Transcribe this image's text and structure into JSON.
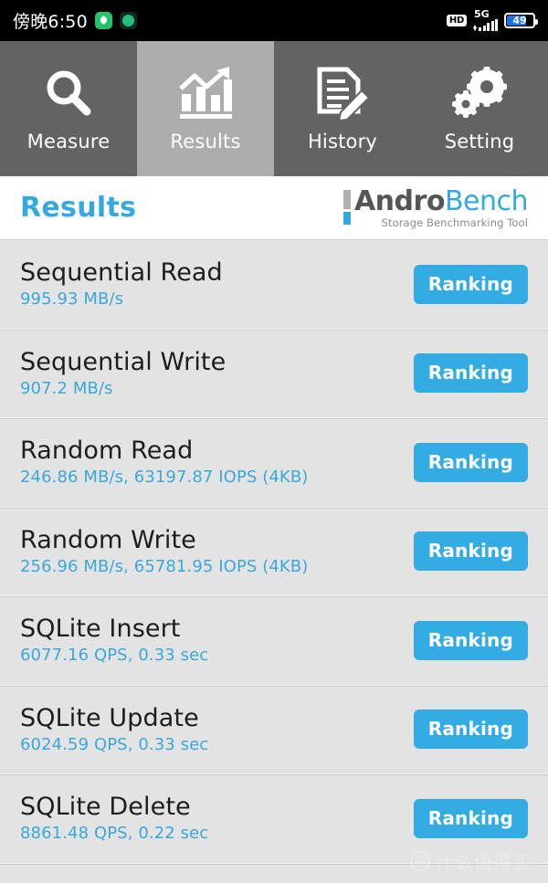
{
  "statusbar": {
    "time": "傍晚6:50",
    "app_icon_1": "shield-app-icon",
    "app_icon_2": "circle-app-icon",
    "hd_label": "HD",
    "network_label": "5G",
    "signal_icon": "signal-bars-icon",
    "battery_percent": "49",
    "battery_icon": "battery-icon"
  },
  "tabs": [
    {
      "label": "Measure",
      "icon": "magnifier-icon",
      "active": false
    },
    {
      "label": "Results",
      "icon": "bar-chart-icon",
      "active": true
    },
    {
      "label": "History",
      "icon": "document-pencil-icon",
      "active": false
    },
    {
      "label": "Setting",
      "icon": "gears-icon",
      "active": false
    }
  ],
  "header": {
    "title": "Results",
    "logo_andro": "Andro",
    "logo_bench": "Bench",
    "logo_subtitle": "Storage Benchmarking Tool"
  },
  "results": {
    "ranking_label": "Ranking",
    "rows": [
      {
        "name": "Sequential Read",
        "value": "995.93 MB/s"
      },
      {
        "name": "Sequential Write",
        "value": "907.2 MB/s"
      },
      {
        "name": "Random Read",
        "value": "246.86 MB/s, 63197.87 IOPS (4KB)"
      },
      {
        "name": "Random Write",
        "value": "256.96 MB/s, 65781.95 IOPS (4KB)"
      },
      {
        "name": "SQLite Insert",
        "value": "6077.16 QPS, 0.33 sec"
      },
      {
        "name": "SQLite Update",
        "value": "6024.59 QPS, 0.33 sec"
      },
      {
        "name": "SQLite Delete",
        "value": "8861.48 QPS, 0.22 sec"
      }
    ]
  },
  "watermark": {
    "mark": "值",
    "text": "什么值得买"
  },
  "colors": {
    "accent_blue": "#33ace4",
    "title_blue": "#33a9e0",
    "value_blue": "#39a8dd",
    "tab_bg": "#636363",
    "tab_active_bg": "#adadad",
    "row_bg": "#e3e3e3",
    "statusbar_bg": "#000000"
  }
}
